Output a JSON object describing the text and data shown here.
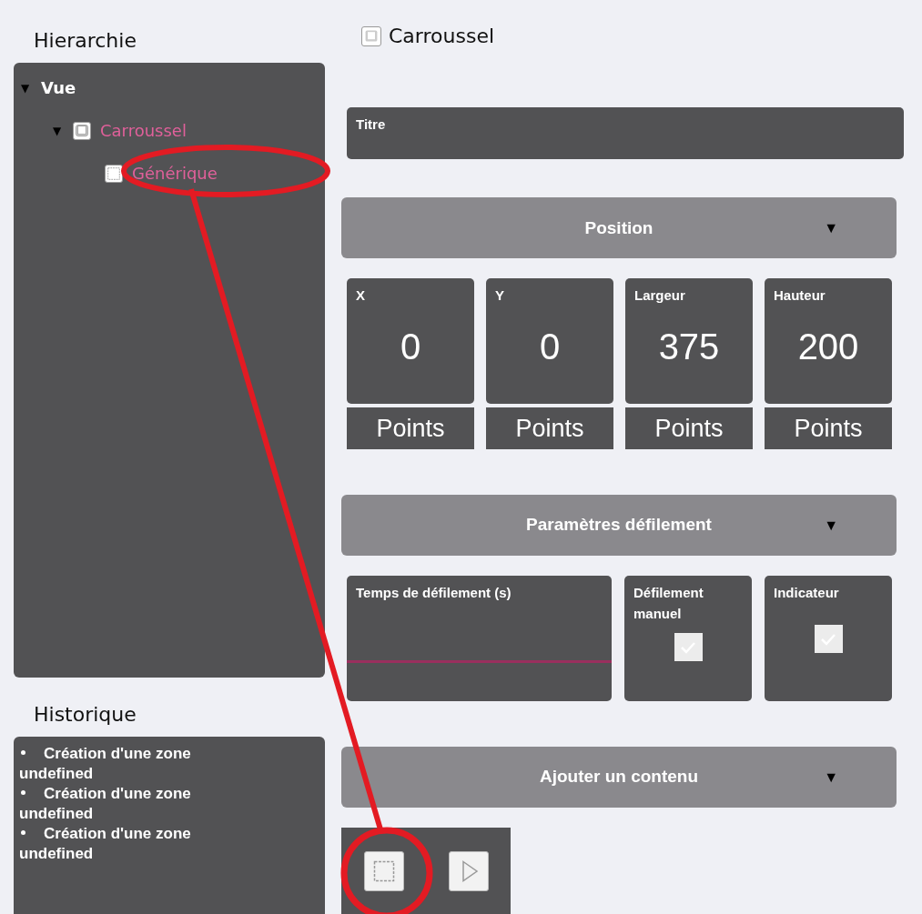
{
  "hierarchy": {
    "title": "Hierarchie",
    "tree": [
      {
        "label": "Vue",
        "kind": "view",
        "expanded": true,
        "toggle": "▼",
        "children": [
          {
            "label": "Carroussel",
            "kind": "carousel",
            "expanded": true,
            "toggle": "▼",
            "children": [
              {
                "label": "Générique",
                "kind": "generic"
              }
            ]
          }
        ]
      }
    ]
  },
  "history": {
    "title": "Historique",
    "items": [
      "Création d'une zone undefined",
      "Création d'une zone undefined",
      "Création d'une zone undefined"
    ]
  },
  "editor": {
    "title": "Carroussel",
    "title_field": {
      "label": "Titre"
    },
    "sections": [
      {
        "title": "Position",
        "toggle": "▼",
        "kind": "position",
        "fields": [
          {
            "label": "X",
            "value": "0",
            "unit": "Points"
          },
          {
            "label": "Y",
            "value": "0",
            "unit": "Points"
          },
          {
            "label": "Largeur",
            "value": "375",
            "unit": "Points"
          },
          {
            "label": "Hauteur",
            "value": "200",
            "unit": "Points"
          }
        ]
      },
      {
        "title": "Paramètres défilement",
        "toggle": "▼",
        "kind": "scroll",
        "fields": [
          {
            "label": "Temps de défilement (s)",
            "kind": "input"
          },
          {
            "label": "Défilement manuel",
            "kind": "checkbox",
            "checked": true
          },
          {
            "label": "Indicateur",
            "kind": "checkbox",
            "checked": true
          }
        ]
      },
      {
        "title": "Ajouter un contenu",
        "toggle": "▼",
        "kind": "add",
        "tools": [
          {
            "kind": "generic"
          },
          {
            "kind": "video"
          }
        ]
      }
    ]
  }
}
